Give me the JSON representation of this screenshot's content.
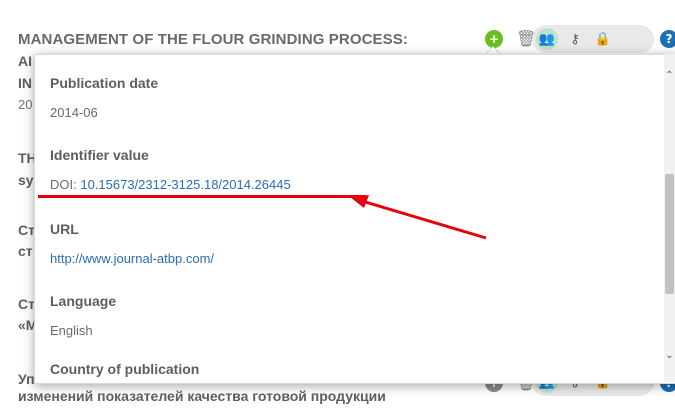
{
  "background": {
    "record_title_line1": "MANAGEMENT OF THE FLOUR GRINDING PROCESS:",
    "record_title_line2_fragment": "AI",
    "record_title_line3_fragment": "IN",
    "year_fragment": "20",
    "item2_fragment_1": "TH",
    "item2_fragment_2": "sy",
    "item3_fragment_1": "Ст",
    "item3_fragment_2": "ст",
    "item4_fragment_1": "Ст",
    "item4_fragment_2": "«М",
    "item5_fragment": "Уп",
    "bottom_line": "изменений показателей качества готовой продукции"
  },
  "popup": {
    "fields": [
      {
        "label": "Publication date",
        "value": "2014-06"
      },
      {
        "label": "Identifier value",
        "prefix": "DOI: ",
        "value": "10.15673/2312-3125.18/2014.26445"
      },
      {
        "label": "URL",
        "value": "http://www.journal-atbp.com/"
      },
      {
        "label": "Language",
        "value": "English"
      },
      {
        "label": "Country of publication",
        "value": ""
      }
    ]
  },
  "colors": {
    "link": "#2a6db5",
    "add_icon": "#6abf1e",
    "group_icon": "#1a9a4a",
    "help_icon": "#1a6fb5",
    "annotation": "#e8000b"
  },
  "icons": [
    "plus-circle-icon",
    "trash-icon",
    "group-icon",
    "key-icon",
    "lock-icon",
    "help-icon",
    "chevron-up-icon",
    "chevron-down-icon"
  ]
}
